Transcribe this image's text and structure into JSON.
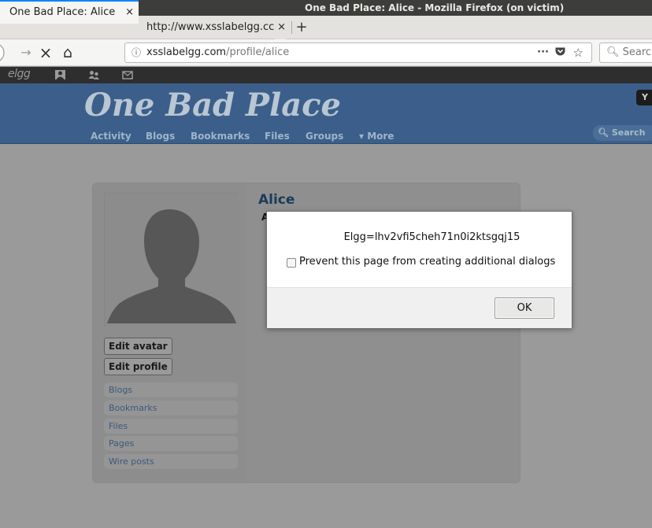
{
  "window": {
    "title": "One Bad Place: Alice - Mozilla Firefox (on victim)"
  },
  "tabs": [
    {
      "label": "One Bad Place: Alice",
      "close": "×"
    },
    {
      "label": "http://www.xsslabelgg.cc",
      "close": "×"
    }
  ],
  "new_tab": "+",
  "nav": {
    "back": "←",
    "forward": "→",
    "stop": "×",
    "home": "⌂",
    "url_info": "ⓘ",
    "url_host": "xsslabelgg.com",
    "url_path": "/profile/alice",
    "page_actions": "···",
    "search_placeholder": "Search"
  },
  "elgg_topbar": {
    "logo": "elgg"
  },
  "header": {
    "site_name": "One Bad Place",
    "menu": [
      "Activity",
      "Blogs",
      "Bookmarks",
      "Files",
      "Groups",
      "▾ More"
    ],
    "search_label": "Search",
    "user_badge": "Y"
  },
  "profile": {
    "name": "Alice",
    "sub": "A",
    "buttons": [
      "Edit avatar",
      "Edit profile"
    ],
    "owner_menu": [
      "Blogs",
      "Bookmarks",
      "Files",
      "Pages",
      "Wire posts"
    ]
  },
  "dialog": {
    "message": "Elgg=lhv2vfi5cheh71n0i2ktsgqj15",
    "checkbox_label": "Prevent this page from creating additional dialogs",
    "checkbox_checked": false,
    "ok_label": "OK"
  },
  "colors": {
    "accent": "#0a84ff",
    "header_blue": "#3b5f8a",
    "link": "#1b3c5a"
  }
}
